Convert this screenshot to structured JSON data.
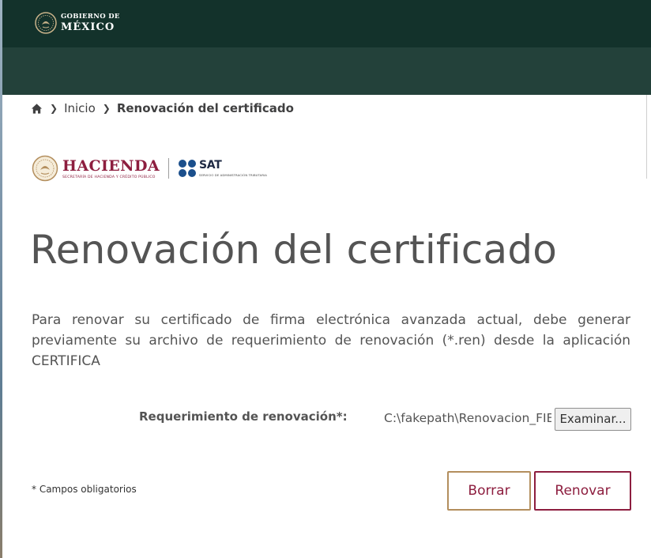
{
  "header": {
    "gov_small": "GOBIERNO DE",
    "gov_big": "MÉXICO"
  },
  "breadcrumb": {
    "home_icon": "home-icon",
    "items": [
      "Inicio",
      "Renovación del certificado"
    ]
  },
  "logos": {
    "hacienda_name": "HACIENDA",
    "hacienda_sub": "SECRETARÍA DE HACIENDA Y CRÉDITO PÚBLICO",
    "sat_name": "SAT",
    "sat_sub": "SERVICIO DE ADMINISTRACIÓN TRIBUTARIA"
  },
  "main": {
    "title": "Renovación del certificado",
    "intro": "Para renovar su certificado de firma electrónica avanzada actual, debe generar previamente su archivo de requerimiento de renovación (*.ren) desde la aplicación CERTIFICA"
  },
  "form": {
    "req_label": "Requerimiento de renovación*:",
    "file_value": "C:\\fakepath\\Renovacion_FIEL.ren",
    "browse_label": "Examinar...",
    "required_note": "* Campos obligatorios",
    "clear_label": "Borrar",
    "renew_label": "Renovar"
  },
  "colors": {
    "header_dark": "#13322b",
    "header_sub": "#23413a",
    "brand_guinda": "#8d1e3f",
    "brand_gold": "#b38e5d",
    "text": "#545454"
  }
}
